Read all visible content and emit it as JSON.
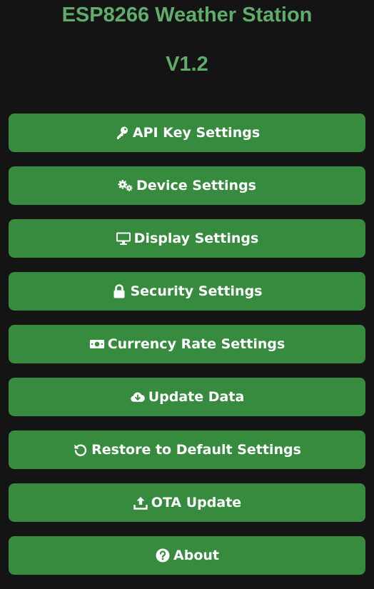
{
  "header": {
    "title": "ESP8266 Weather Station",
    "version": "V1.2"
  },
  "menu": {
    "items": [
      {
        "label": "API Key Settings",
        "icon": "key-icon"
      },
      {
        "label": "Device Settings",
        "icon": "gears-icon"
      },
      {
        "label": "Display Settings",
        "icon": "monitor-icon"
      },
      {
        "label": "Security Settings",
        "icon": "lock-icon"
      },
      {
        "label": "Currency Rate Settings",
        "icon": "money-bill-icon"
      },
      {
        "label": "Update Data",
        "icon": "cloud-download-icon"
      },
      {
        "label": "Restore to Default Settings",
        "icon": "undo-icon"
      },
      {
        "label": "OTA Update",
        "icon": "upload-icon"
      },
      {
        "label": "About",
        "icon": "question-circle-icon"
      }
    ]
  },
  "colors": {
    "background": "#141414",
    "title": "#5fad6b",
    "button": "#368b3e",
    "button_text": "#ffffff"
  }
}
